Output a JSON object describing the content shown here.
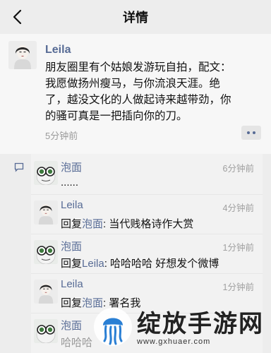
{
  "nav": {
    "title": "详情",
    "back_icon": "chevron-left-icon"
  },
  "post": {
    "author": "Leila",
    "lines": [
      "朋友圈里有个姑娘发游玩自拍，配文：",
      "我愿做扬州瘦马，与你流浪天涯。绝",
      "了，越没文化的人做起诗来越带劲，你",
      "的骚可真是一把插向你的刀。"
    ],
    "time": "5分钟前",
    "more_icon": "more-dots-icon"
  },
  "comments": [
    {
      "name": "泡面",
      "time": "6分钟前",
      "text": "......",
      "reply_prefix": "",
      "reply_to": "",
      "avatar": "cartoon-avatar"
    },
    {
      "name": "Leila",
      "time": "4分钟前",
      "text": ": 当代贱格诗作大赏",
      "reply_prefix": "回复",
      "reply_to": "泡面",
      "avatar": "girl-avatar"
    },
    {
      "name": "泡面",
      "time": "1分钟前",
      "text": ": 哈哈哈哈 好想发个微博",
      "reply_prefix": "回复",
      "reply_to": "Leila",
      "avatar": "cartoon-avatar"
    },
    {
      "name": "Leila",
      "time": "1分钟前",
      "text": ": 署名我",
      "reply_prefix": "回复",
      "reply_to": "泡面",
      "avatar": "girl-avatar"
    },
    {
      "name": "泡面",
      "time": "",
      "text": "哈哈哈",
      "reply_prefix": "",
      "reply_to": "",
      "avatar": "cartoon-avatar"
    }
  ],
  "watermark": {
    "title": "绽放手游网",
    "url": "www.gxhuaer.com"
  },
  "colors": {
    "link": "#576b95",
    "background": "#ededed",
    "comments_bg": "#f2f2f2"
  }
}
